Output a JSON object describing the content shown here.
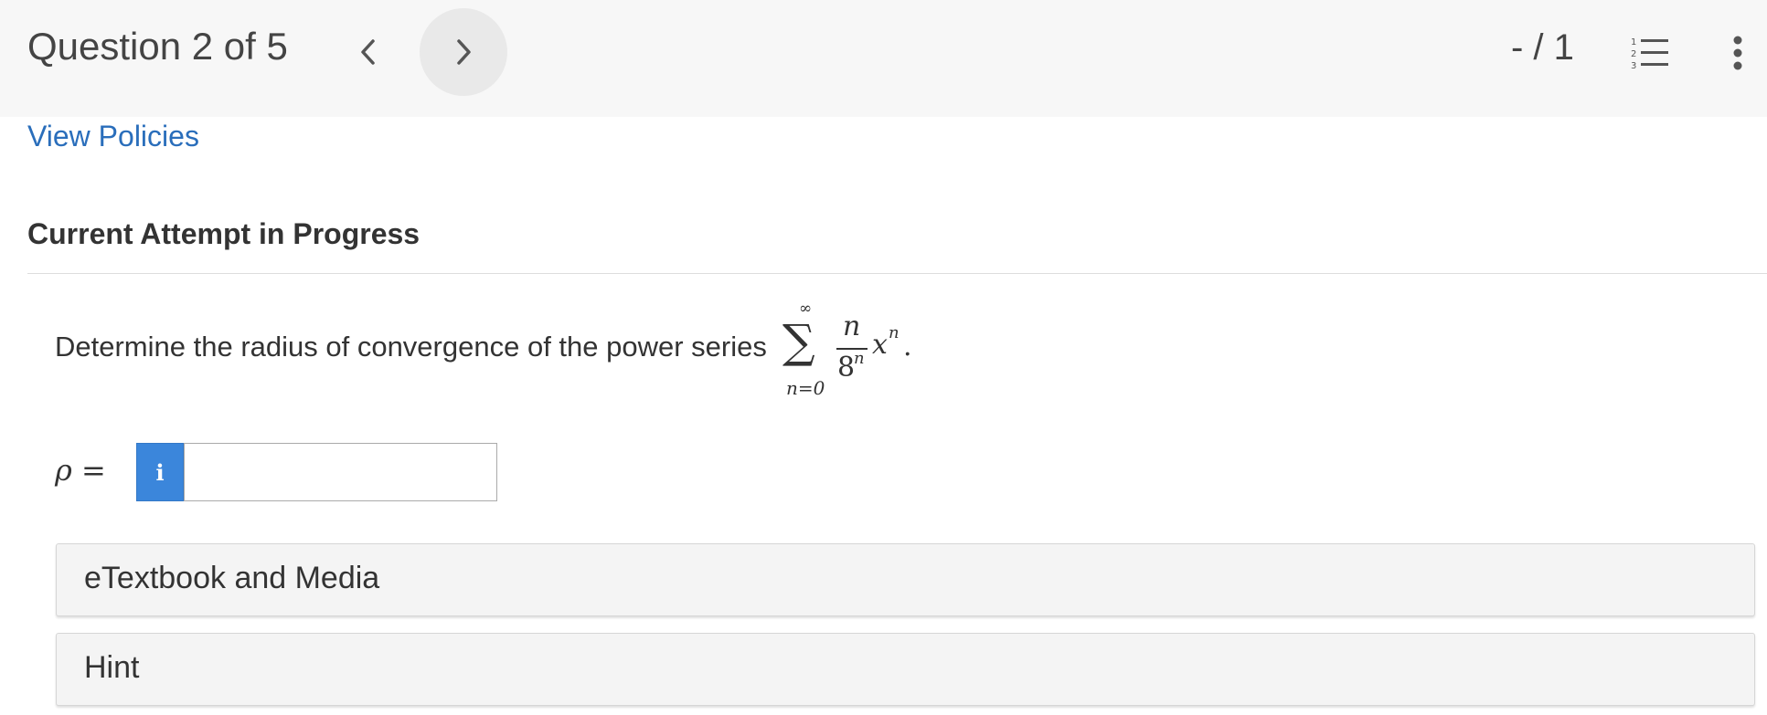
{
  "header": {
    "question_label": "Question 2 of 5",
    "score": "- / 1",
    "prev_icon": "chevron-left-icon",
    "next_icon": "chevron-right-icon",
    "list_icon": "numbered-list-icon",
    "more_icon": "more-vertical-icon"
  },
  "policies_link": "View Policies",
  "attempt_heading": "Current Attempt in Progress",
  "question": {
    "text": "Determine the radius of convergence of the power series",
    "math": {
      "sum_upper": "∞",
      "sigma": "∑",
      "sum_lower": "n=0",
      "numerator": "n",
      "denominator_base": "8",
      "denominator_exp": "n",
      "variable": "x",
      "variable_exp": "n",
      "period": "."
    }
  },
  "answer": {
    "label_var": "ρ",
    "label_eq": " =",
    "info_button": "i",
    "value": "",
    "placeholder": ""
  },
  "panels": {
    "etextbook": "eTextbook and Media",
    "hint": "Hint"
  },
  "colors": {
    "link": "#2a6ebb",
    "info_button": "#3b86db",
    "header_bg": "#f7f7f7",
    "panel_bg": "#f4f4f4"
  }
}
